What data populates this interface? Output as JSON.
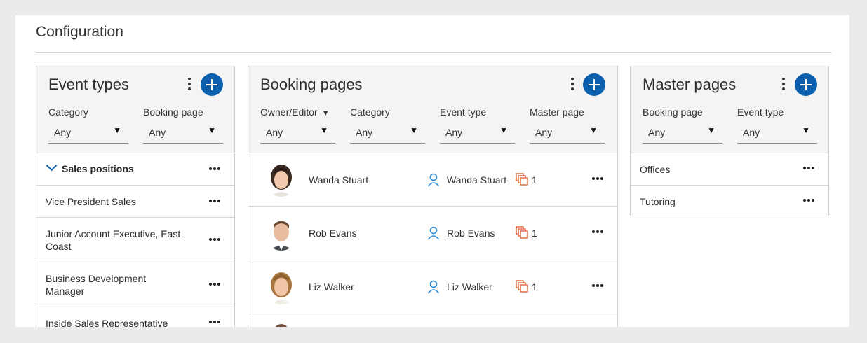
{
  "page": {
    "title": "Configuration"
  },
  "event_types": {
    "title": "Event types",
    "filters": [
      {
        "label": "Category",
        "value": "Any"
      },
      {
        "label": "Booking page",
        "value": "Any"
      }
    ],
    "group": {
      "label": "Sales positions"
    },
    "items": [
      {
        "label": "Vice President Sales"
      },
      {
        "label": "Junior Account Executive, East Coast"
      },
      {
        "label": "Business Development Manager"
      },
      {
        "label": "Inside Sales Representative"
      }
    ]
  },
  "booking_pages": {
    "title": "Booking pages",
    "filters": [
      {
        "label": "Owner/Editor",
        "value": "Any"
      },
      {
        "label": "Category",
        "value": "Any"
      },
      {
        "label": "Event type",
        "value": "Any"
      },
      {
        "label": "Master page",
        "value": "Any"
      }
    ],
    "items": [
      {
        "name": "Wanda Stuart",
        "owner": "Wanda Stuart",
        "count": "1"
      },
      {
        "name": "Rob Evans",
        "owner": "Rob Evans",
        "count": "1"
      },
      {
        "name": "Liz Walker",
        "owner": "Liz Walker",
        "count": "1"
      }
    ]
  },
  "master_pages": {
    "title": "Master pages",
    "filters": [
      {
        "label": "Booking page",
        "value": "Any"
      },
      {
        "label": "Event type",
        "value": "Any"
      }
    ],
    "items": [
      {
        "label": "Offices"
      },
      {
        "label": "Tutoring"
      }
    ]
  },
  "colors": {
    "accent": "#0b5fad",
    "copy_icon": "#e0603a",
    "user_icon": "#2a8ad8"
  },
  "icons": {
    "add": "plus-icon",
    "more": "ellipsis-icon",
    "menu": "vertical-dots-icon",
    "owner": "user-icon",
    "copies": "copy-icon",
    "expand": "chevron-down-icon"
  }
}
